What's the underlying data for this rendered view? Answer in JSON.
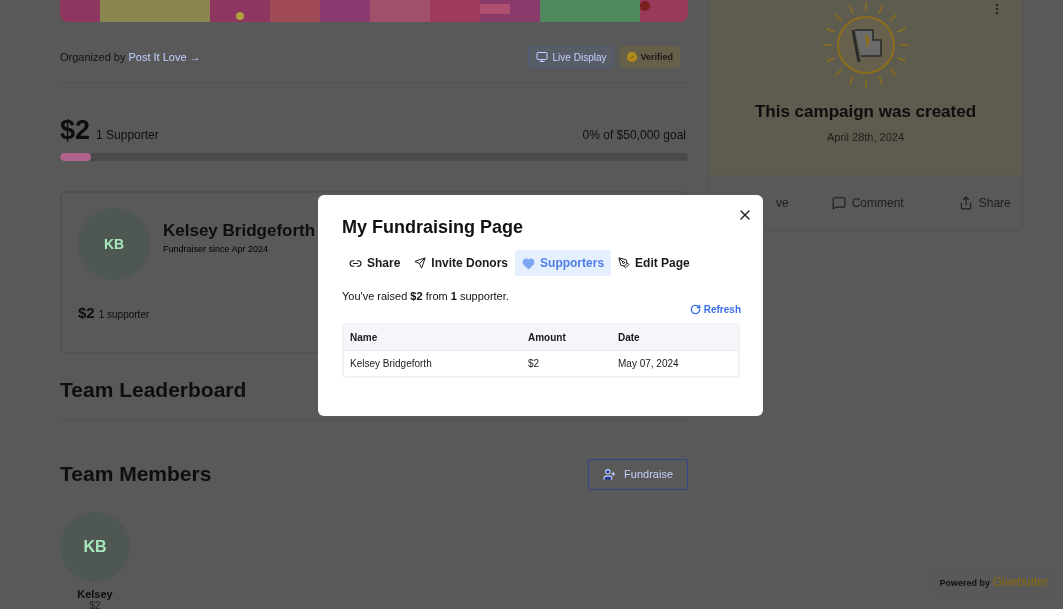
{
  "organizer": {
    "prefix": "Organized by",
    "link": "Post It Love →"
  },
  "header_actions": [
    {
      "label": "Live Display",
      "kind": "button"
    },
    {
      "label": "Verified",
      "kind": "badge"
    }
  ],
  "progress": {
    "amount": "$2",
    "supporters": "1 Supporter",
    "goal": "0% of $50,000 goal",
    "level": 0.05
  },
  "fundraiser_card": {
    "initials": "KB",
    "name": "Kelsey Bridgeforth",
    "since": "Fundraiser since Apr 2024",
    "amount": "$2",
    "supporters": "1 supporter"
  },
  "leaderboard_title": "Team Leaderboard",
  "members_section": {
    "title": "Team Members",
    "button": "Fundraise",
    "members": [
      {
        "initials": "KB",
        "name": "Kelsey",
        "amount": "$2"
      }
    ]
  },
  "campaign_card": {
    "title": "This campaign was created",
    "date": "April 28th, 2024",
    "actions": [
      {
        "label": "ve",
        "kind": "save"
      },
      {
        "label": "Comment",
        "kind": "comment"
      },
      {
        "label": "Share",
        "kind": "share"
      }
    ]
  },
  "powered_by": {
    "prefix": "Powered by",
    "brand": "Givebutter"
  },
  "modal": {
    "title": "My Fundraising Page",
    "tabs": [
      {
        "label": "Share",
        "kind": "link",
        "selected": false
      },
      {
        "label": "Invite Donors",
        "kind": "send",
        "selected": false
      },
      {
        "label": "Supporters",
        "kind": "heart",
        "selected": true
      },
      {
        "label": "Edit Page",
        "kind": "pen",
        "selected": false
      }
    ],
    "summary": "You've raised **$2** from **1** supporter.",
    "refresh": "Refresh",
    "table": {
      "columns": [
        "Name",
        "Amount",
        "Date"
      ],
      "rows": [
        [
          "Kelsey Bridgeforth",
          "$2",
          "May 07, 2024"
        ]
      ]
    }
  }
}
